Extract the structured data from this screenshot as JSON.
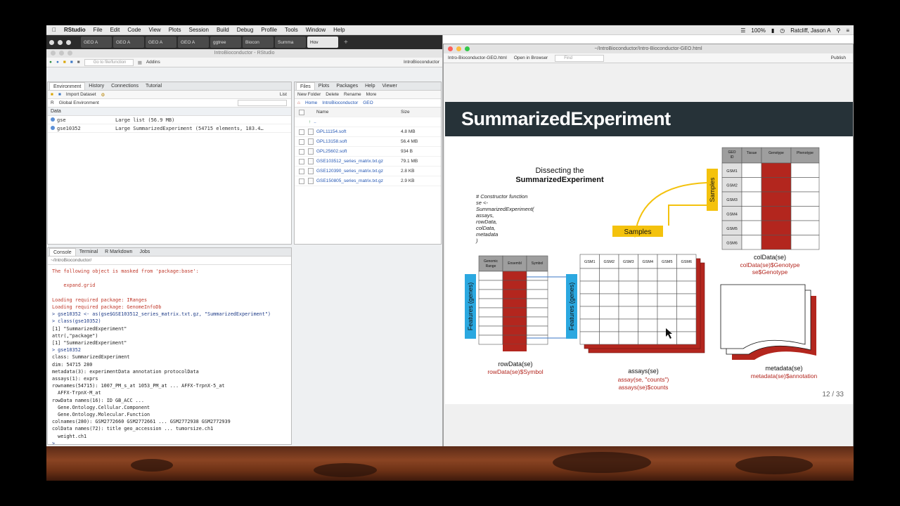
{
  "menubar": {
    "apple": "",
    "items": [
      "RStudio",
      "File",
      "Edit",
      "Code",
      "View",
      "Plots",
      "Session",
      "Build",
      "Debug",
      "Profile",
      "Tools",
      "Window",
      "Help"
    ],
    "battery": "100%",
    "user": "Ratcliff, Jason A"
  },
  "browser_tabs": [
    "GEO A",
    "GEO A",
    "GEO A",
    "GEO A",
    "ggtree",
    "Biocon",
    "Summa",
    "Hov"
  ],
  "rstudio": {
    "title": "IntroBioconductor - RStudio",
    "goto_placeholder": "Go to file/function",
    "addins": "Addins",
    "project": "IntroBioconductor",
    "env_tabs": [
      "Environment",
      "History",
      "Connections",
      "Tutorial"
    ],
    "env_toolbar": {
      "import": "Import Dataset",
      "list": "List",
      "lang": "R",
      "scope": "Global Environment"
    },
    "env_section": "Data",
    "env_rows": [
      {
        "name": "gse",
        "value": "Large list (56.9 MB)"
      },
      {
        "name": "gse10352",
        "value": "Large SummarizedExperiment (54715 elements,  183.4…"
      }
    ],
    "files_tabs": [
      "Files",
      "Plots",
      "Packages",
      "Help",
      "Viewer"
    ],
    "files_toolbar": {
      "new_folder": "New Folder",
      "delete": "Delete",
      "rename": "Rename",
      "more": "More"
    },
    "breadcrumb": [
      "Home",
      "IntroBioconductor",
      "GEO"
    ],
    "files_header": {
      "name": "Name",
      "size": "Size"
    },
    "up": "..",
    "files": [
      {
        "name": "GPL11154.soft",
        "size": "4.8 MB"
      },
      {
        "name": "GPL13158.soft",
        "size": "56.4 MB"
      },
      {
        "name": "GPL25602.soft",
        "size": "934 B"
      },
      {
        "name": "GSE103512_series_matrix.txt.gz",
        "size": "79.1 MB"
      },
      {
        "name": "GSE120390_series_matrix.txt.gz",
        "size": "2.8 KB"
      },
      {
        "name": "GSE150805_series_matrix.txt.gz",
        "size": "2.9 KB"
      }
    ],
    "console_tabs": [
      "Console",
      "Terminal",
      "R Markdown",
      "Jobs"
    ],
    "console_path": "~/IntroBioconductor/",
    "console_lines": [
      {
        "t": "The following object is masked from 'package:base':",
        "c": "red"
      },
      {
        "t": "",
        "c": ""
      },
      {
        "t": "    expand.grid",
        "c": "red"
      },
      {
        "t": "",
        "c": ""
      },
      {
        "t": "Loading required package: IRanges",
        "c": "red"
      },
      {
        "t": "Loading required package: GenomeInfoDb",
        "c": "red"
      },
      {
        "t": "> gse10352 <- as(gse$GSE103512_series_matrix.txt.gz, \"SummarizedExperiment\")",
        "c": "blue"
      },
      {
        "t": "> class(gse10352)",
        "c": "blue"
      },
      {
        "t": "[1] \"SummarizedExperiment\"",
        "c": ""
      },
      {
        "t": "attr(,\"package\")",
        "c": ""
      },
      {
        "t": "[1] \"SummarizedExperiment\"",
        "c": ""
      },
      {
        "t": "> gse10352",
        "c": "blue"
      },
      {
        "t": "class: SummarizedExperiment",
        "c": ""
      },
      {
        "t": "dim: 54715 280",
        "c": ""
      },
      {
        "t": "metadata(3): experimentData annotation protocolData",
        "c": ""
      },
      {
        "t": "assays(1): exprs",
        "c": ""
      },
      {
        "t": "rownames(54715): 1007_PM_s_at 1053_PM_at ... AFFX-TrpnX-5_at",
        "c": ""
      },
      {
        "t": "  AFFX-TrpnX-M_at",
        "c": ""
      },
      {
        "t": "rowData names(16): ID GB_ACC ...",
        "c": ""
      },
      {
        "t": "  Gene.Ontology.Cellular.Component",
        "c": ""
      },
      {
        "t": "  Gene.Ontology.Molecular.Function",
        "c": ""
      },
      {
        "t": "colnames(280): GSM2772660 GSM2772661 ... GSM2772938 GSM2772939",
        "c": ""
      },
      {
        "t": "colData names(72): title geo_accession ... tumorsize.ch1",
        "c": ""
      },
      {
        "t": "  weight.ch1",
        "c": ""
      },
      {
        "t": ">",
        "c": "blue"
      }
    ]
  },
  "viewer": {
    "title": "~/IntroBioconductor/Intro-Bioconductor-GEO.html",
    "file": "Intro-Bioconductor-GEO.html",
    "open_browser": "Open in Browser",
    "find_placeholder": "Find",
    "publish": "Publish",
    "slide": {
      "heading": "SummarizedExperiment",
      "page": "12 / 33",
      "diagram_title_1": "Dissecting the",
      "diagram_title_2": "SummarizedExperiment",
      "code": [
        "# Constructor function",
        "se <-",
        "  SummarizedExperiment(",
        "    assays,",
        "    rowData,",
        "    colData,",
        "    metadata",
        "  )"
      ],
      "samples": "Samples",
      "features": "Features (genes)",
      "row_headers": [
        "Genomic Range",
        "Ensembl",
        "Symbol"
      ],
      "assay_headers": [
        "GSM1",
        "GSM2",
        "GSM3",
        "GSM4",
        "GSM5",
        "GSM6"
      ],
      "col_headers": [
        "GEO ID",
        "Tissue",
        "Genotype",
        "Phenotype"
      ],
      "col_ids": [
        "GSM1",
        "GSM2",
        "GSM3",
        "GSM4",
        "GSM5",
        "GSM6"
      ],
      "rowdata_label": "rowData(se)",
      "rowdata_sub": "rowData(se)$Symbol",
      "assays_label": "assays(se)",
      "assays_sub1": "assay(se, \"counts\")",
      "assays_sub2": "assays(se)$counts",
      "coldata_label": "colData(se)",
      "coldata_sub1": "colData(se)$Genotype",
      "coldata_sub2": "se$Genotype",
      "metadata_label": "metadata(se)",
      "metadata_sub": "metadata(se)$annotation"
    }
  },
  "colors": {
    "accent_red": "#b3261e",
    "accent_yellow": "#f4c20d",
    "feature_blue": "#2ba8e0",
    "slide_header": "#263238"
  }
}
